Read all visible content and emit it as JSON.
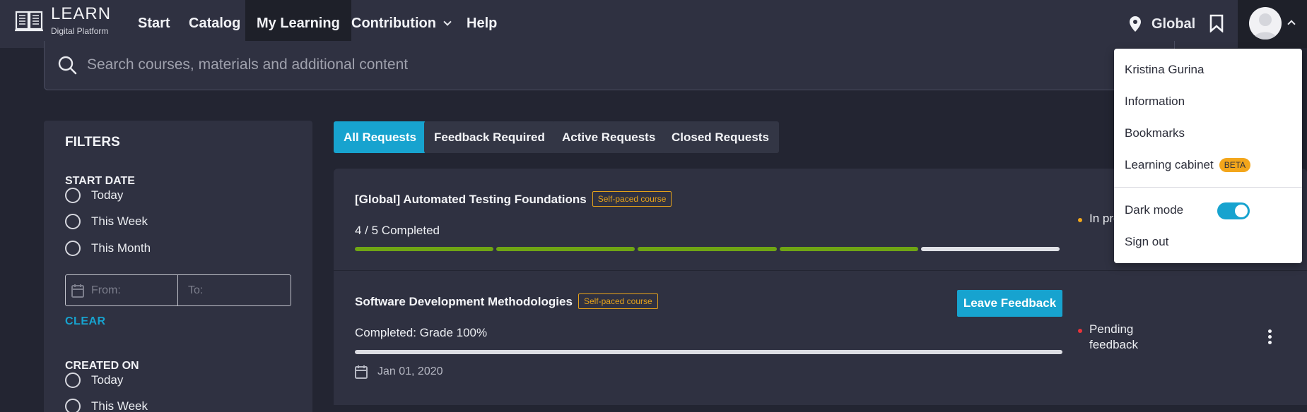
{
  "nav": {
    "logo_title": "LEARN",
    "logo_subtitle": "Digital Platform",
    "items": [
      {
        "label": "Start"
      },
      {
        "label": "Catalog"
      },
      {
        "label": "My Learning"
      },
      {
        "label": "Contribution"
      },
      {
        "label": "Help"
      }
    ],
    "location": "Global"
  },
  "search": {
    "placeholder": "Search courses, materials and additional content"
  },
  "filters": {
    "title": "FILTERS",
    "start_date": {
      "title": "START DATE",
      "options": [
        "Today",
        "This Week",
        "This Month"
      ],
      "from_placeholder": "From:",
      "to_placeholder": "To:",
      "clear": "CLEAR"
    },
    "created_on": {
      "title": "CREATED ON",
      "options": [
        "Today",
        "This Week"
      ]
    }
  },
  "tabs": [
    {
      "label": "All Requests",
      "active": true
    },
    {
      "label": "Feedback Required"
    },
    {
      "label": "Active Requests"
    },
    {
      "label": "Closed Requests"
    }
  ],
  "requests": [
    {
      "title": "[Global] Automated Testing Foundations",
      "badge": "Self-paced course",
      "progress_text": "4 / 5 Completed",
      "completed_segments": 4,
      "total_segments": 5,
      "status": "In progress",
      "status_color": "#f2a71b"
    },
    {
      "title": "Software Development Methodologies",
      "badge": "Self-paced course",
      "progress_text": "Completed: Grade 100%",
      "button": "Leave Feedback",
      "status_line1": "Pending",
      "status_line2": "feedback",
      "status_color": "#e8343a",
      "date": "Jan 01, 2020"
    }
  ],
  "user_menu": {
    "name": "Kristina Gurina",
    "items": [
      "Information",
      "Bookmarks",
      "Learning cabinet"
    ],
    "beta": "BETA",
    "dark_mode": "Dark mode",
    "dark_mode_on": true,
    "sign_out": "Sign out"
  },
  "colors": {
    "accent": "#17a3cf",
    "progress": "#6fa514",
    "badge": "#e5a21a"
  }
}
